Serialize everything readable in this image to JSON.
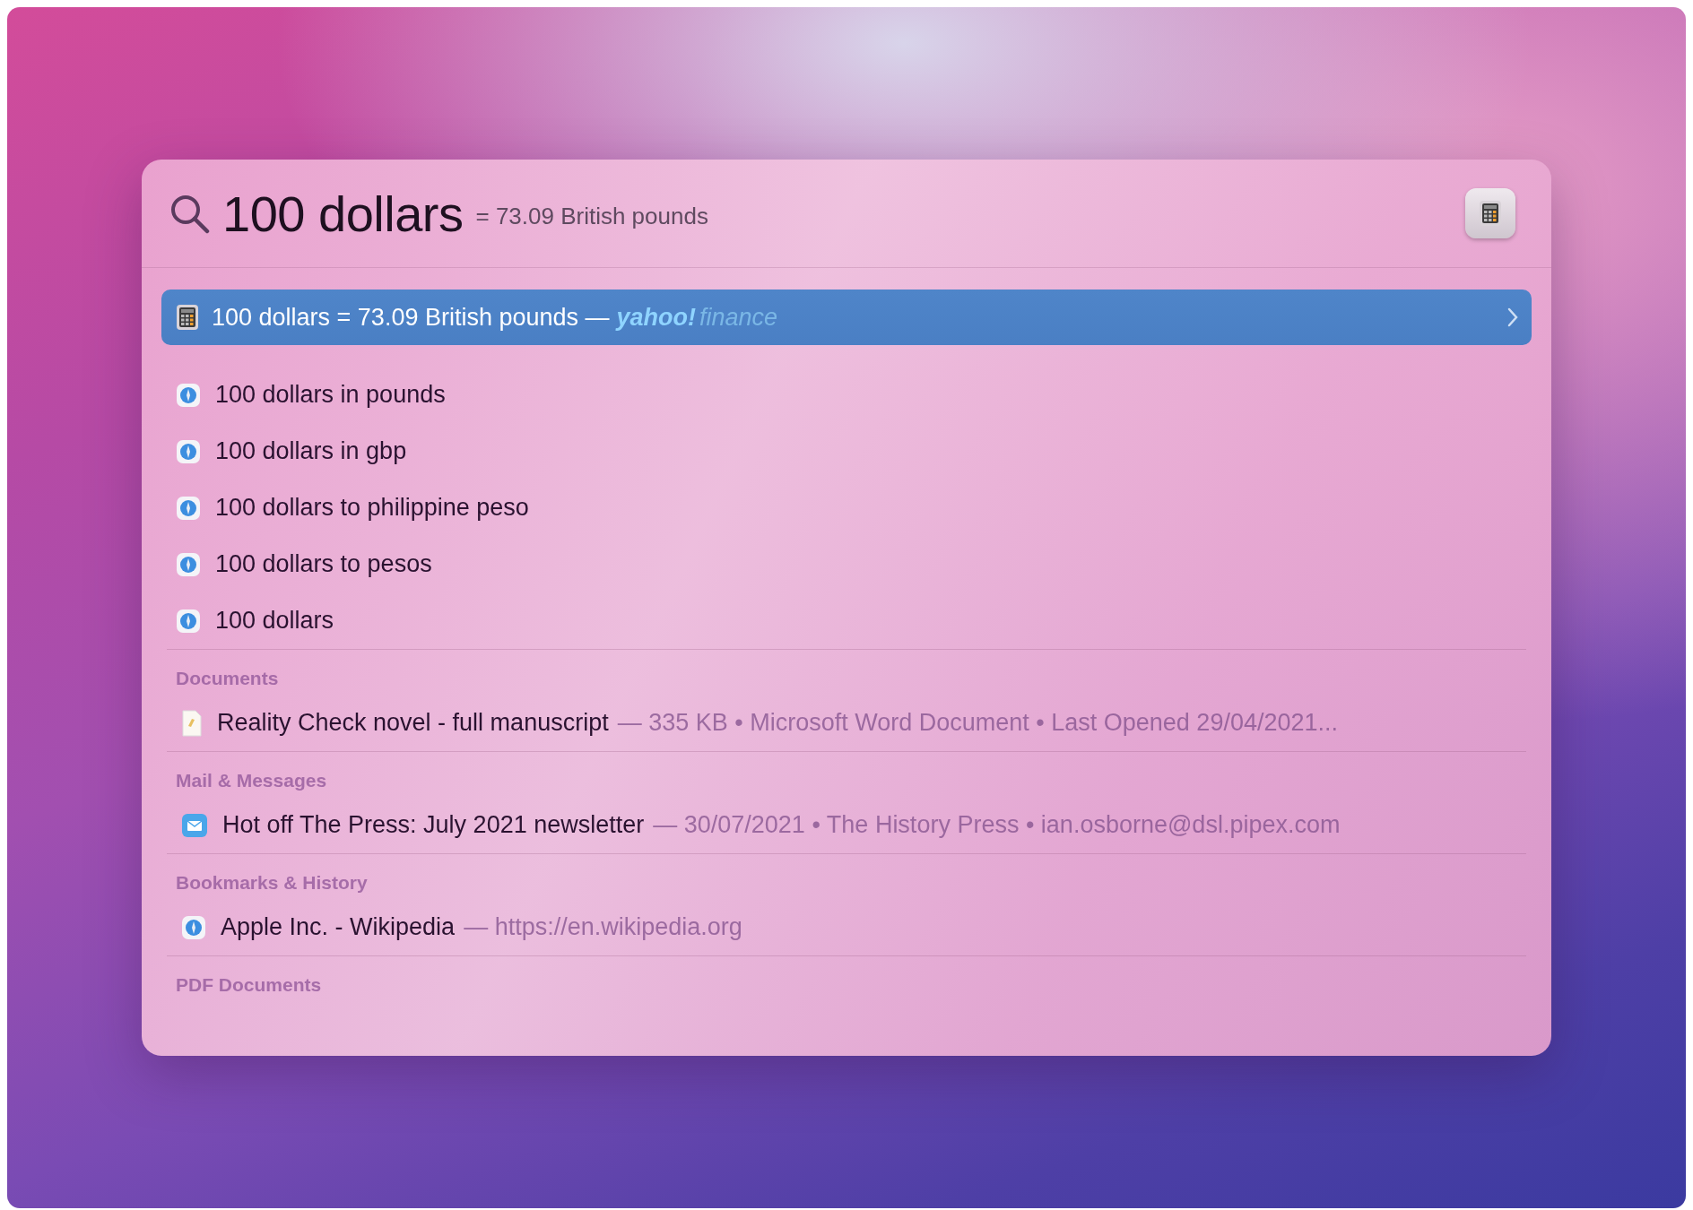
{
  "search": {
    "query": "100 dollars",
    "result": "= 73.09 British pounds"
  },
  "top_hit": {
    "kind": "calculator",
    "title": "100 dollars = 73.09 British pounds —",
    "source_name": "yahoo!",
    "source_section": "finance",
    "selected": true
  },
  "suggestions": [
    {
      "kind": "web",
      "label": "100 dollars in pounds",
      "selected": false
    },
    {
      "kind": "web",
      "label": "100 dollars in gbp",
      "selected": false
    },
    {
      "kind": "web",
      "label": "100 dollars to philippine peso",
      "selected": false
    },
    {
      "kind": "web",
      "label": "100 dollars to pesos",
      "selected": false
    },
    {
      "kind": "web",
      "label": "100 dollars",
      "selected": false
    }
  ],
  "sections": [
    {
      "heading": "Documents",
      "items": [
        {
          "kind": "document",
          "title": "Reality Check novel - full manuscript",
          "detail": "— 335 KB • Microsoft Word Document • Last Opened 29/04/2021...",
          "selected": false
        }
      ]
    },
    {
      "heading": "Mail & Messages",
      "items": [
        {
          "kind": "mail",
          "title": "Hot off The Press: July 2021 newsletter",
          "detail": "— 30/07/2021 • The History Press • ian.osborne@dsl.pipex.com",
          "selected": false
        }
      ]
    },
    {
      "heading": "Bookmarks & History",
      "items": [
        {
          "kind": "web",
          "title": "Apple Inc. - Wikipedia",
          "detail": "— https://en.wikipedia.org",
          "selected": false
        }
      ]
    },
    {
      "heading": "PDF Documents"
    }
  ]
}
